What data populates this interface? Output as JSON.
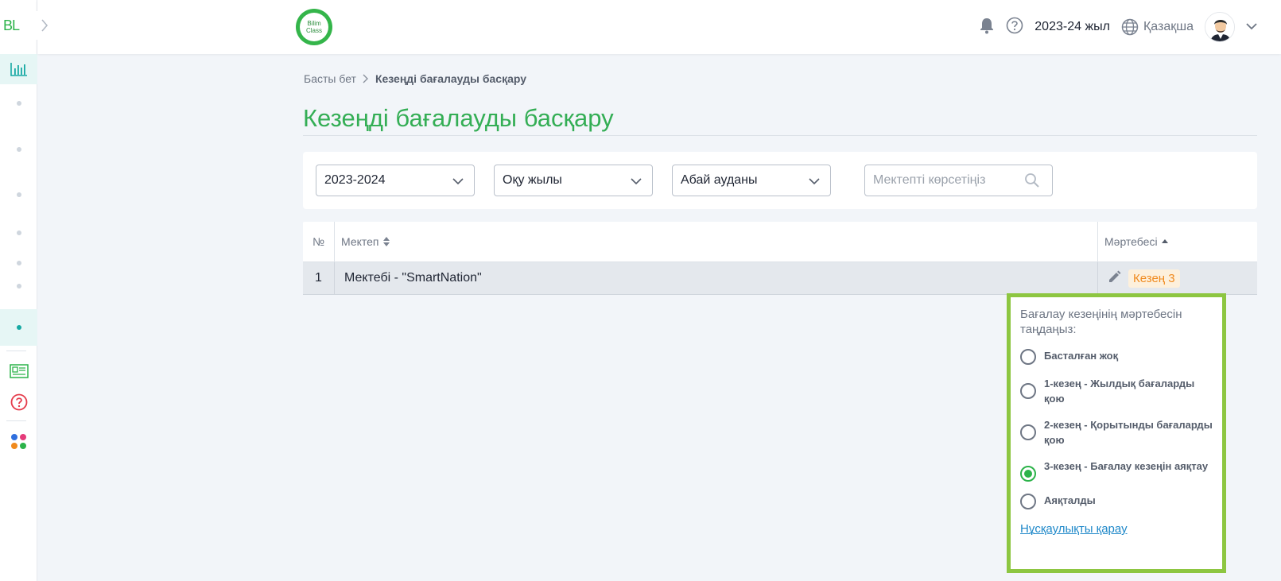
{
  "sidebar": {
    "logo": "BL"
  },
  "header": {
    "brand_line1": "Bilim",
    "brand_line2": "Class",
    "year": "2023-24 жыл",
    "language": "Қазақша"
  },
  "breadcrumb": {
    "home": "Басты бет",
    "current": "Кезеңді бағалауды басқару"
  },
  "page_title": "Кезеңді бағалауды басқару",
  "filters": {
    "year": "2023-2024",
    "period": "Оқу жылы",
    "district": "Абай ауданы",
    "search_placeholder": "Мектепті көрсетіңіз"
  },
  "table": {
    "headers": {
      "no": "№",
      "school": "Мектеп",
      "status": "Мәртебесі"
    },
    "rows": [
      {
        "no": "1",
        "school": "Мектебі - \"SmartNation\"",
        "status": "Кезең 3"
      }
    ]
  },
  "popover": {
    "title": "Бағалау кезеңінің мәртебесін таңдаңыз:",
    "options": [
      {
        "label": "Басталған жоқ",
        "selected": false
      },
      {
        "label": "1-кезең - Жылдық бағаларды қою",
        "selected": false
      },
      {
        "label": "2-кезең - Қорытынды бағаларды қою",
        "selected": false
      },
      {
        "label": "3-кезең - Бағалау кезеңін аяқтау",
        "selected": true
      },
      {
        "label": "Аяқталды",
        "selected": false
      }
    ],
    "link": "Нұсқаулықты қарау"
  },
  "colors": {
    "brand_green": "#2cb34a",
    "title_green": "#34ae55",
    "popover_border": "#8dc641",
    "badge_text": "#f08a1e",
    "link_blue": "#1e88c9"
  }
}
